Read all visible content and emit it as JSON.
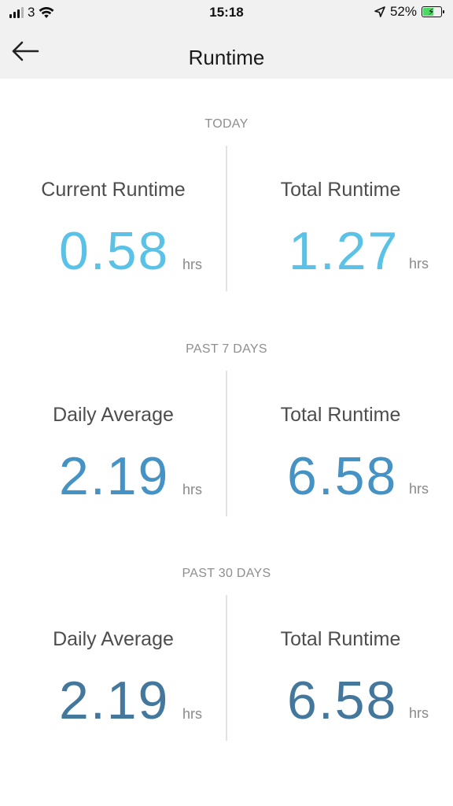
{
  "status_bar": {
    "carrier": "3",
    "time": "15:18",
    "battery": "52%",
    "icons": [
      "signal-icon",
      "wifi-icon",
      "location-icon",
      "battery-charging-icon"
    ]
  },
  "nav": {
    "title": "Runtime",
    "back_icon": "arrow-left-icon"
  },
  "sections": [
    {
      "label": "TODAY",
      "left": {
        "label": "Current Runtime",
        "value": "0.58",
        "unit": "hrs"
      },
      "right": {
        "label": "Total Runtime",
        "value": "1.27",
        "unit": "hrs"
      },
      "color": "#5bc2e7"
    },
    {
      "label": "PAST 7 DAYS",
      "left": {
        "label": "Daily Average",
        "value": "2.19",
        "unit": "hrs"
      },
      "right": {
        "label": "Total Runtime",
        "value": "6.58",
        "unit": "hrs"
      },
      "color": "#4593c4"
    },
    {
      "label": "PAST 30 DAYS",
      "left": {
        "label": "Daily Average",
        "value": "2.19",
        "unit": "hrs"
      },
      "right": {
        "label": "Total Runtime",
        "value": "6.58",
        "unit": "hrs"
      },
      "color": "#43779c"
    }
  ]
}
